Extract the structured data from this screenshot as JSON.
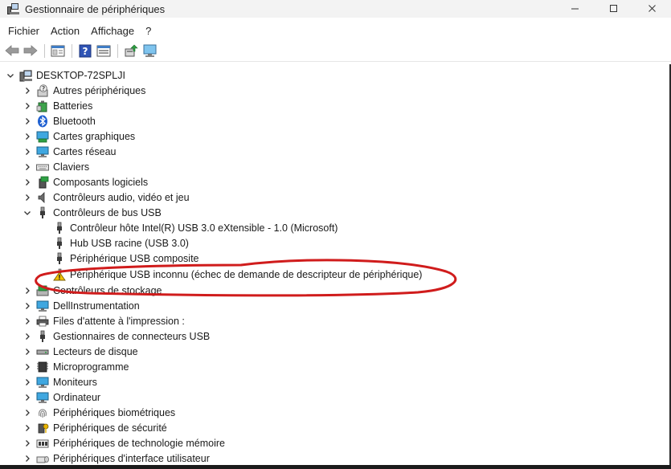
{
  "window": {
    "title": "Gestionnaire de périphériques",
    "controls": {
      "minimize": "–",
      "maximize": "□",
      "close": "✕"
    }
  },
  "menu": [
    "Fichier",
    "Action",
    "Affichage",
    "?"
  ],
  "toolbar": [
    "back-arrow-icon",
    "forward-arrow-icon",
    "properties-icon",
    "help-icon",
    "view-icon",
    "update-driver-icon",
    "scan-hardware-icon"
  ],
  "tree": {
    "root": "DESKTOP-72SPLJI",
    "categories": [
      {
        "label": "Autres périphériques",
        "icon": "unknown-device-icon"
      },
      {
        "label": "Batteries",
        "icon": "battery-icon"
      },
      {
        "label": "Bluetooth",
        "icon": "bluetooth-icon"
      },
      {
        "label": "Cartes graphiques",
        "icon": "display-adapter-icon"
      },
      {
        "label": "Cartes réseau",
        "icon": "network-adapter-icon"
      },
      {
        "label": "Claviers",
        "icon": "keyboard-icon"
      },
      {
        "label": "Composants logiciels",
        "icon": "software-component-icon"
      },
      {
        "label": "Contrôleurs audio, vidéo et jeu",
        "icon": "speaker-icon"
      },
      {
        "label": "Contrôleurs de bus USB",
        "icon": "usb-icon",
        "expanded": true,
        "children": [
          {
            "label": "Contrôleur hôte Intel(R) USB 3.0 eXtensible - 1.0 (Microsoft)",
            "icon": "usb-icon"
          },
          {
            "label": "Hub USB racine (USB 3.0)",
            "icon": "usb-icon"
          },
          {
            "label": "Périphérique USB composite",
            "icon": "usb-icon"
          },
          {
            "label": "Périphérique USB inconnu (échec de demande de descripteur de périphérique)",
            "icon": "warning-icon"
          }
        ]
      },
      {
        "label": "Contrôleurs de stockage",
        "icon": "storage-controller-icon"
      },
      {
        "label": "DellInstrumentation",
        "icon": "monitor-icon"
      },
      {
        "label": "Files d'attente à l'impression :",
        "icon": "printer-icon"
      },
      {
        "label": "Gestionnaires de connecteurs USB",
        "icon": "usb-icon"
      },
      {
        "label": "Lecteurs de disque",
        "icon": "disk-drive-icon"
      },
      {
        "label": "Microprogramme",
        "icon": "firmware-icon"
      },
      {
        "label": "Moniteurs",
        "icon": "monitor-icon"
      },
      {
        "label": "Ordinateur",
        "icon": "computer-icon"
      },
      {
        "label": "Périphériques biométriques",
        "icon": "fingerprint-icon"
      },
      {
        "label": "Périphériques de sécurité",
        "icon": "security-key-icon"
      },
      {
        "label": "Périphériques de technologie mémoire",
        "icon": "memory-icon"
      },
      {
        "label": "Périphériques d'interface utilisateur",
        "icon": "hid-icon"
      }
    ]
  },
  "colors": {
    "annotation": "#d01c1c",
    "warning": "#f2c200",
    "monitor": "#3fa7e0",
    "bluetooth": "#1d5fd1",
    "usb": "#3a3a3a"
  }
}
